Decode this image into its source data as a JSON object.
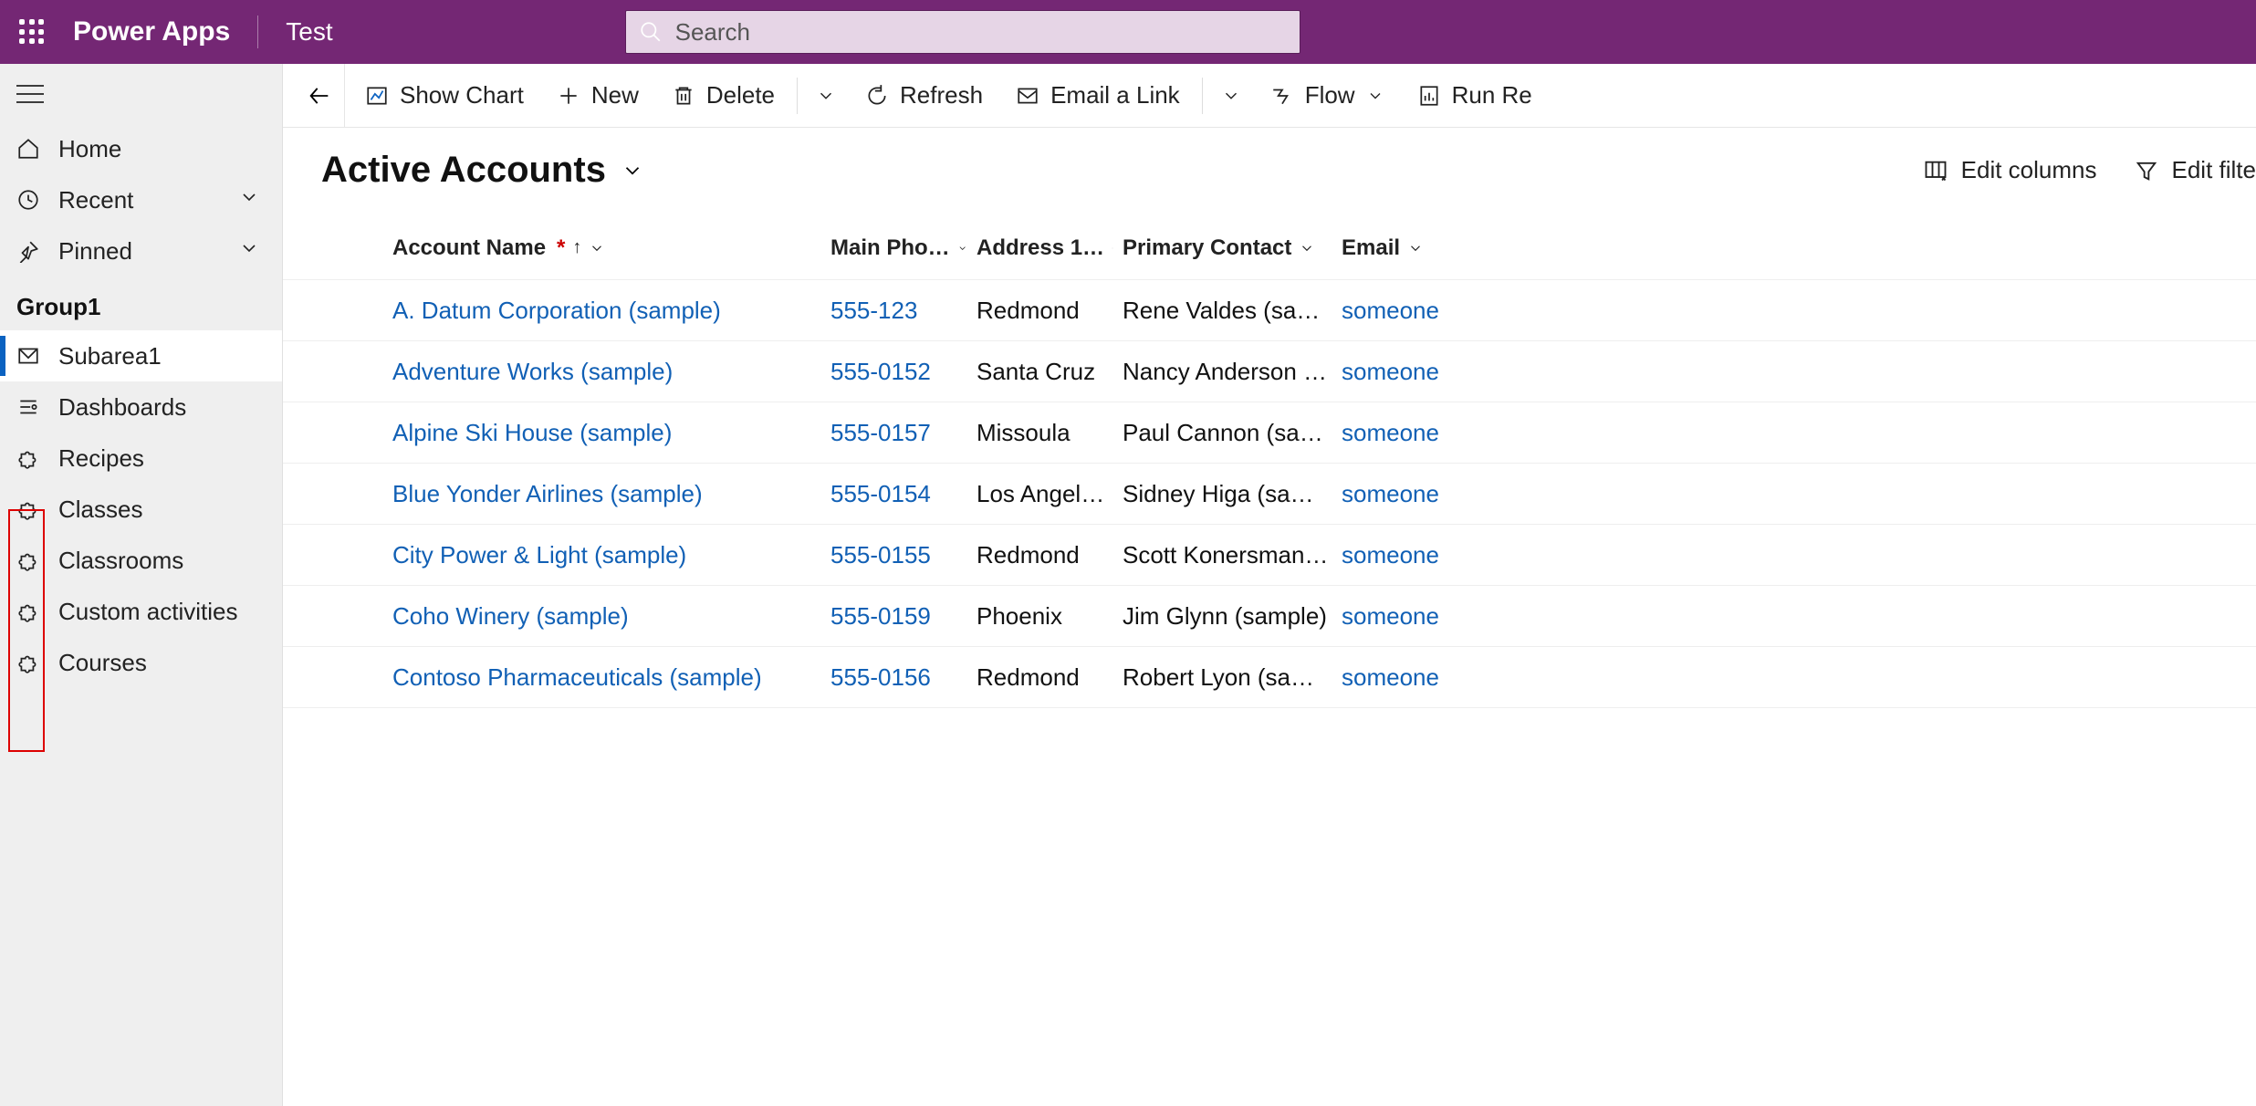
{
  "header": {
    "brand": "Power Apps",
    "env": "Test",
    "search_placeholder": "Search"
  },
  "sidebar": {
    "home": "Home",
    "recent": "Recent",
    "pinned": "Pinned",
    "group_label": "Group1",
    "items": [
      {
        "label": "Subarea1"
      },
      {
        "label": "Dashboards"
      },
      {
        "label": "Recipes"
      },
      {
        "label": "Classes"
      },
      {
        "label": "Classrooms"
      },
      {
        "label": "Custom activities"
      },
      {
        "label": "Courses"
      }
    ]
  },
  "commands": {
    "show_chart": "Show Chart",
    "new": "New",
    "delete": "Delete",
    "refresh": "Refresh",
    "email_link": "Email a Link",
    "flow": "Flow",
    "run_report": "Run Re"
  },
  "view": {
    "title": "Active Accounts",
    "edit_columns": "Edit columns",
    "edit_filters": "Edit filte"
  },
  "columns": {
    "name": "Account Name",
    "phone": "Main Pho…",
    "city": "Address 1…",
    "contact": "Primary Contact",
    "email": "Email"
  },
  "rows": [
    {
      "name": "A. Datum Corporation (sample)",
      "phone": "555-123",
      "city": "Redmond",
      "contact": "Rene Valdes (sam…",
      "email": "someone"
    },
    {
      "name": "Adventure Works (sample)",
      "phone": "555-0152",
      "city": "Santa Cruz",
      "contact": "Nancy Anderson (…",
      "email": "someone"
    },
    {
      "name": "Alpine Ski House (sample)",
      "phone": "555-0157",
      "city": "Missoula",
      "contact": "Paul Cannon (sam…",
      "email": "someone"
    },
    {
      "name": "Blue Yonder Airlines (sample)",
      "phone": "555-0154",
      "city": "Los Angel…",
      "contact": "Sidney Higa (sam…",
      "email": "someone"
    },
    {
      "name": "City Power & Light (sample)",
      "phone": "555-0155",
      "city": "Redmond",
      "contact": "Scott Konersman…",
      "email": "someone"
    },
    {
      "name": "Coho Winery (sample)",
      "phone": "555-0159",
      "city": "Phoenix",
      "contact": "Jim Glynn (sample)",
      "email": "someone"
    },
    {
      "name": "Contoso Pharmaceuticals (sample)",
      "phone": "555-0156",
      "city": "Redmond",
      "contact": "Robert Lyon (sam…",
      "email": "someone"
    }
  ]
}
